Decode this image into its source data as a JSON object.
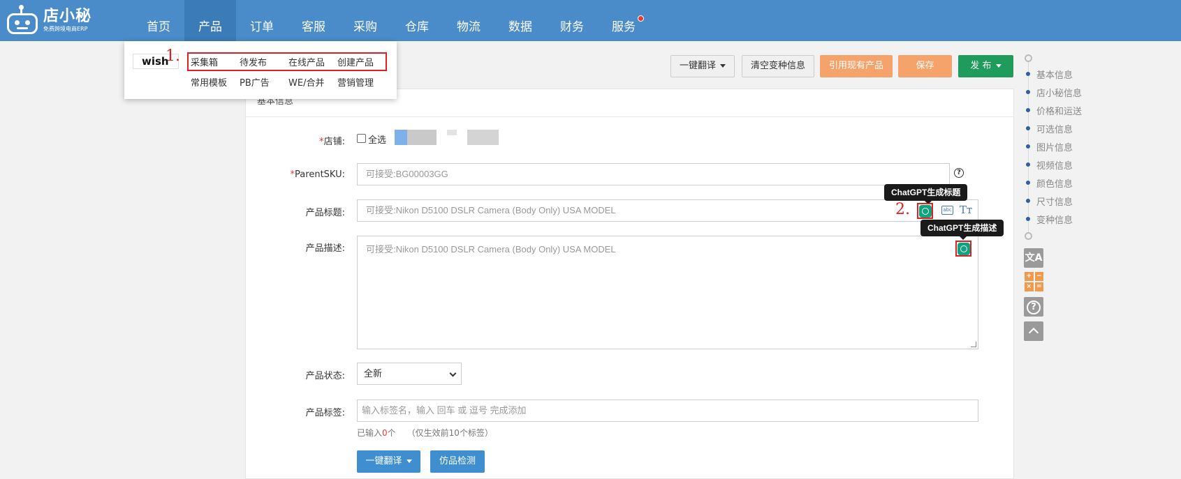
{
  "logo": {
    "name": "店小秘",
    "subtitle": "免费跨境电商ERP"
  },
  "nav": {
    "items": [
      "首页",
      "产品",
      "订单",
      "客服",
      "采购",
      "仓库",
      "物流",
      "数据",
      "财务",
      "服务"
    ],
    "active": "产品"
  },
  "dropdown": {
    "platform": "wish",
    "row1": [
      "采集箱",
      "待发布",
      "在线产品",
      "创建产品"
    ],
    "row2": [
      "常用模板",
      "PB广告",
      "WE/合并",
      "营销管理"
    ],
    "step1": "1."
  },
  "toolbar": {
    "translate": "一键翻译",
    "clear_variants": "清空变种信息",
    "reference": "引用现有产品",
    "save": "保存",
    "publish": "发 布"
  },
  "section": {
    "title": "基本信息"
  },
  "form": {
    "shop_label": "店铺:",
    "select_all": "全选",
    "parent_sku_label": "ParentSKU:",
    "parent_sku_placeholder": "可接受:BG00003GG",
    "title_label": "产品标题:",
    "title_placeholder": "可接受:Nikon D5100 DSLR Camera (Body Only) USA MODEL",
    "desc_label": "产品描述:",
    "desc_placeholder": "可接受:Nikon D5100 DSLR Camera (Body Only) USA MODEL",
    "status_label": "产品状态:",
    "status_value": "全新",
    "tags_label": "产品标签:",
    "tags_placeholder": "输入标签名，输入 回车 或 逗号 完成添加",
    "tags_count_prefix": "已输入",
    "tags_count": "0",
    "tags_count_suffix": "个",
    "tags_note": "（仅生效前10个标签）",
    "translate_btn": "一键翻译",
    "counterfeit_btn": "仿品检测"
  },
  "tooltips": {
    "title_gpt": "ChatGPT生成标题",
    "desc_gpt": "ChatGPT生成描述",
    "step2": "2."
  },
  "sidebar": {
    "items": [
      "基本信息",
      "店小秘信息",
      "价格和运送",
      "可选信息",
      "图片信息",
      "视频信息",
      "颜色信息",
      "尺寸信息",
      "变种信息"
    ]
  },
  "colors": {
    "nav_bg": "#4a8cc9",
    "accent_orange": "#f5a36a",
    "accent_green": "#1f9b5c",
    "highlight_red": "#e02020"
  }
}
